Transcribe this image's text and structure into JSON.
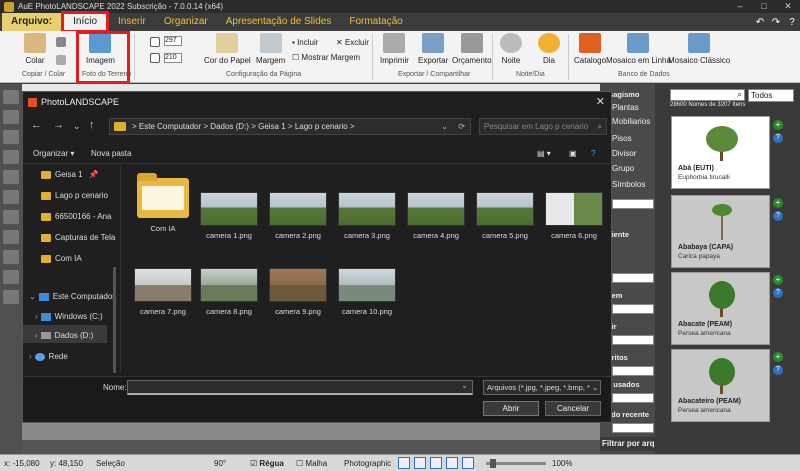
{
  "window": {
    "title": "AuE PhotoLANDSCAPE 2022 Subscrição - 7.0.0.14 (x64)"
  },
  "menu": {
    "tabs": [
      "Arquivo:",
      "Início",
      "Inserir",
      "Organizar",
      "Apresentação de Slides",
      "Formatação"
    ]
  },
  "ribbon": {
    "buttons": {
      "colar": "Colar",
      "imagem": "Imagem",
      "cor_papel": "Cor do Papel",
      "margem": "Margem",
      "imprimir": "Imprimir",
      "exportar": "Exportar",
      "orcamento": "Orçamento",
      "noite": "Noite",
      "dia": "Dia",
      "catalogo": "Catalogo",
      "mosaico_linha": "Mosaico em Linha",
      "mosaico_classico": "Mosaico Clássico"
    },
    "small": {
      "incluir": "Incluir",
      "excluir": "Excluir",
      "mostrar_margem": "Mostrar Margem",
      "width": "297",
      "height": "210"
    },
    "groups": {
      "copiar_colar": "Copiar / Colar",
      "foto_terreno": "Foto do Terreno",
      "config_pagina": "Configuração da Página",
      "exportar": "Exportar / Compartilhar",
      "noite_dia": "Noite/Dia",
      "banco": "Banco de Dados"
    }
  },
  "right_panel": {
    "filter": "Todos",
    "count": "28600 Nomes de 3207 Itens",
    "plants": [
      {
        "name": "Abá (EUTI)",
        "sci": "Euphorbia tirucalli"
      },
      {
        "name": "Ababaya (CAPA)",
        "sci": "Carica papaya"
      },
      {
        "name": "Abacate (PEAM)",
        "sci": "Persea americana"
      },
      {
        "name": "Abacateiro (PEAM)",
        "sci": "Persea americana"
      }
    ],
    "filtrar": "Filtrar por arqu"
  },
  "categories": {
    "items": [
      "Plantas",
      "Mobiliarios",
      "Pisos",
      "Divisor",
      "Grupo",
      "Símbolos"
    ],
    "head_top": "isagismo",
    "heads": [
      "biente",
      "o",
      "gem",
      "bir",
      "oritos",
      "s usados",
      "ado recente"
    ]
  },
  "dialog": {
    "title": "PhotoLANDSCAPE",
    "address": [
      "Este Computador",
      "Dados (D:)",
      "Geisa 1",
      "Lago p cenario"
    ],
    "search_placeholder": "Pesquisar em Lago p cenario",
    "cmd": {
      "organizar": "Organizar",
      "nova_pasta": "Nova pasta"
    },
    "nav": {
      "quick": [
        "Geisa 1",
        "Lago p cenario",
        "66500166 - Ana",
        "Capturas de Tela",
        "Com IA"
      ],
      "computer": "Este Computador",
      "drives": [
        "Windows (C:)",
        "Dados (D:)"
      ],
      "network": "Rede"
    },
    "files": [
      "Com IA",
      "camera 1.png",
      "camera 2.png",
      "camera 3.png",
      "camera 4.png",
      "camera 5.png",
      "camera 6.png",
      "camera 7.png",
      "camera 8.png",
      "camera 9.png",
      "camera 10.png"
    ],
    "name_label": "Nome:",
    "filetype": "Arquivos (*.jpg, *.jpeg, *.bmp, *",
    "open": "Abrir",
    "cancel": "Cancelar"
  },
  "status": {
    "x": "x: -15,080",
    "y": "y: 48,150",
    "selecao": "Seleção",
    "angle": "90°",
    "regua": "Régua",
    "malha": "Malha",
    "mode": "Photographic",
    "zoom": "100%"
  }
}
